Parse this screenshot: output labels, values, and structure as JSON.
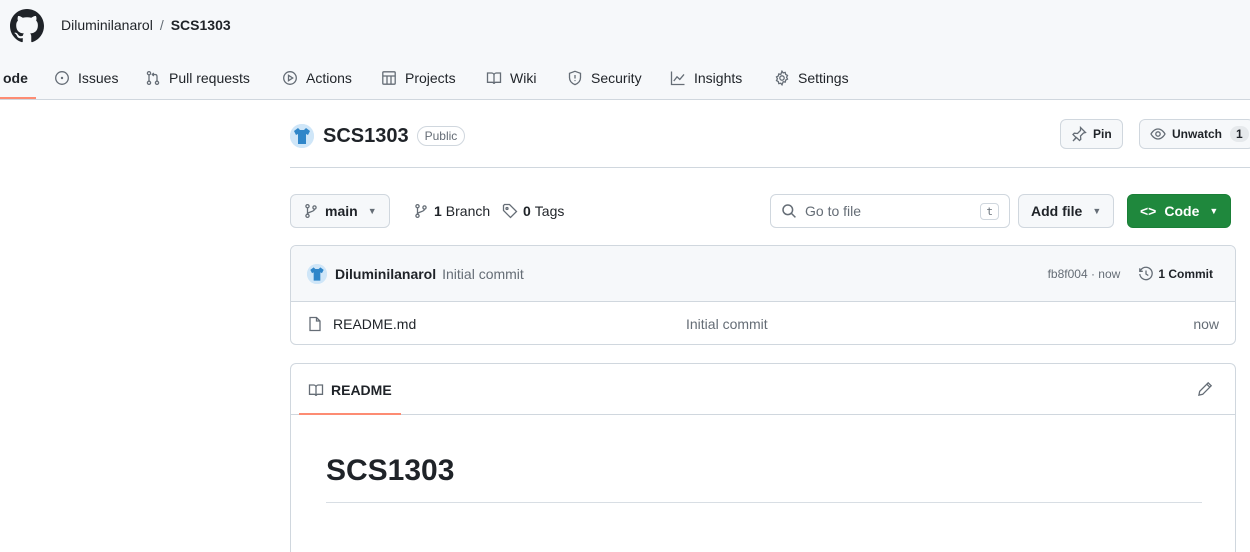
{
  "header": {
    "owner": "Diluminilanarol",
    "separator": "/",
    "repo": "SCS1303"
  },
  "nav": {
    "items": [
      {
        "label": "Code",
        "icon": "code-icon",
        "visible_text": "ode",
        "active": true
      },
      {
        "label": "Issues",
        "icon": "issue-icon"
      },
      {
        "label": "Pull requests",
        "icon": "pull-request-icon"
      },
      {
        "label": "Actions",
        "icon": "play-icon"
      },
      {
        "label": "Projects",
        "icon": "table-icon"
      },
      {
        "label": "Wiki",
        "icon": "book-icon"
      },
      {
        "label": "Security",
        "icon": "shield-icon"
      },
      {
        "label": "Insights",
        "icon": "graph-icon"
      },
      {
        "label": "Settings",
        "icon": "gear-icon"
      }
    ]
  },
  "repo_header": {
    "title": "SCS1303",
    "visibility": "Public",
    "pin_label": "Pin",
    "unwatch_label": "Unwatch",
    "watch_count": "1"
  },
  "toolbar": {
    "branch": "main",
    "branch_count": "1",
    "branch_label": "Branch",
    "tag_count": "0",
    "tag_label": "Tags",
    "search_placeholder": "Go to file",
    "search_shortcut": "t",
    "add_file_label": "Add file",
    "code_label": "Code"
  },
  "latest_commit": {
    "author": "Diluminilanarol",
    "message": "Initial commit",
    "hash_time": "fb8f004 · now",
    "commit_count_label": "1 Commit"
  },
  "files": [
    {
      "name": "README.md",
      "commit": "Initial commit",
      "time": "now"
    }
  ],
  "readme": {
    "tab_label": "README",
    "heading": "SCS1303"
  },
  "colors": {
    "accent_underline": "#fd8c73",
    "code_button": "#1f883d",
    "border": "#d0d7de",
    "muted_text": "#656d76"
  }
}
